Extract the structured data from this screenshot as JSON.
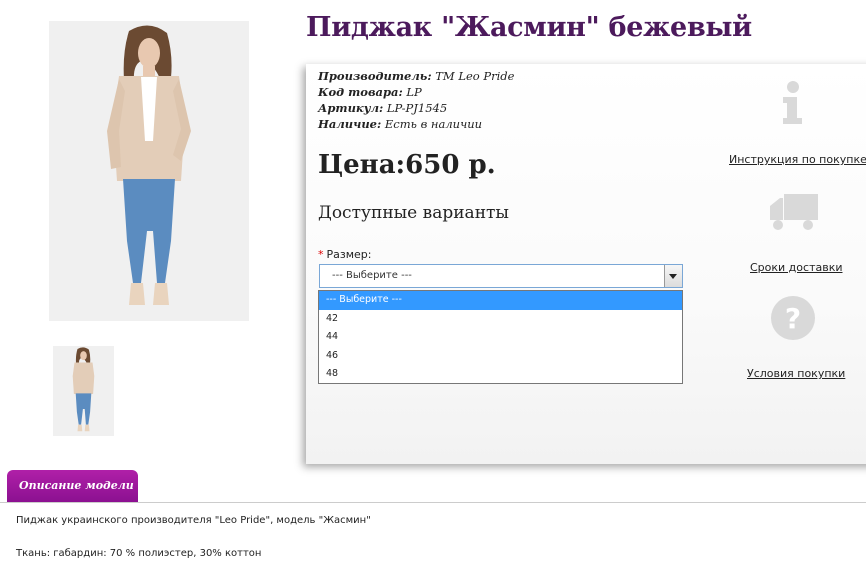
{
  "product": {
    "title": "Пиджак \"Жасмин\" бежевый",
    "specs": [
      {
        "label": "Производитель:",
        "value": "TM Leo Pride"
      },
      {
        "label": "Код товара:",
        "value": "LP"
      },
      {
        "label": "Артикул:",
        "value": "LP-PJ1545"
      },
      {
        "label": "Наличие:",
        "value": "Есть в наличии"
      }
    ],
    "price": "Цена:650 р.",
    "variants_heading": "Доступные варианты"
  },
  "size": {
    "required_mark": "*",
    "label": "Размер:",
    "selected": "--- Выберите ---",
    "options": [
      "--- Выберите ---",
      "42",
      "44",
      "46",
      "48"
    ]
  },
  "sidebar": {
    "links": [
      {
        "label": "Инструкция по покупке",
        "icon": "info-icon"
      },
      {
        "label": "Сроки доставки",
        "icon": "truck-icon"
      },
      {
        "label": "Условия покупки",
        "icon": "question-icon"
      }
    ]
  },
  "tabs": {
    "description": "Описание модели"
  },
  "description": {
    "line1": "Пиджак украинского производителя \"Leo Pride\", модель \"Жасмин\"",
    "line2": "Ткань: габардин: 70 % полиэстер, 30% коттон"
  },
  "colors": {
    "title": "#4c1a5c",
    "tab": "#9a149a",
    "selection": "#3399ff"
  }
}
